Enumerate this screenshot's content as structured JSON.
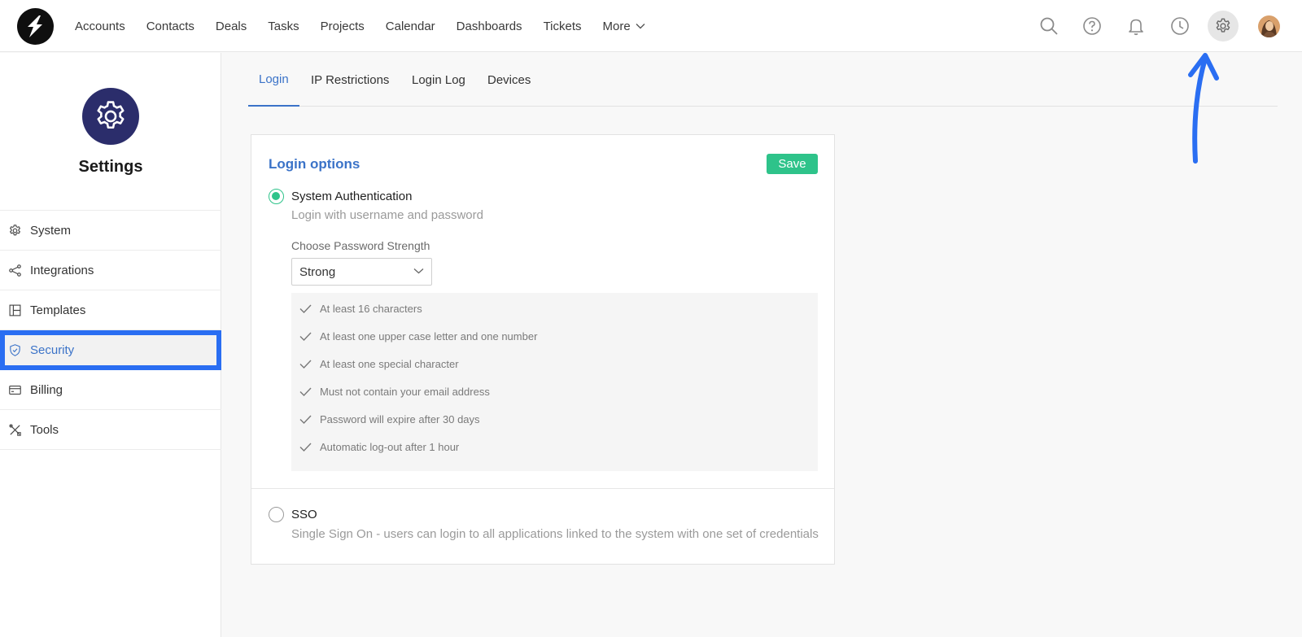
{
  "header": {
    "nav": [
      "Accounts",
      "Contacts",
      "Deals",
      "Tasks",
      "Projects",
      "Calendar",
      "Dashboards",
      "Tickets",
      "More"
    ],
    "icons": [
      "search-icon",
      "help-icon",
      "bell-icon",
      "clock-icon",
      "gear-icon",
      "avatar"
    ],
    "active_icon": "gear-icon"
  },
  "sidebar": {
    "title": "Settings",
    "items": [
      {
        "label": "System",
        "icon": "gear-icon"
      },
      {
        "label": "Integrations",
        "icon": "share-icon"
      },
      {
        "label": "Templates",
        "icon": "template-icon"
      },
      {
        "label": "Security",
        "icon": "shield-icon"
      },
      {
        "label": "Billing",
        "icon": "card-icon"
      },
      {
        "label": "Tools",
        "icon": "tools-icon"
      }
    ],
    "active": "Security"
  },
  "tabs": [
    "Login",
    "IP Restrictions",
    "Login Log",
    "Devices"
  ],
  "active_tab": "Login",
  "login_options": {
    "title": "Login options",
    "save_label": "Save",
    "system_auth": {
      "label": "System Authentication",
      "description": "Login with username and password",
      "selected": true
    },
    "password_strength": {
      "label": "Choose Password Strength",
      "value": "Strong"
    },
    "rules": [
      "At least 16 characters",
      "At least one upper case letter and one number",
      "At least one special character",
      "Must not contain your email address",
      "Password will expire after 30 days",
      "Automatic log-out after 1 hour"
    ],
    "sso": {
      "label": "SSO",
      "description": "Single Sign On - users can login to all applications linked to the system with one set of credentials",
      "selected": false
    }
  },
  "colors": {
    "accent": "#3b73c8",
    "save": "#2ec38a",
    "highlight": "#2a6ef2",
    "badge": "#2b2d6b"
  }
}
